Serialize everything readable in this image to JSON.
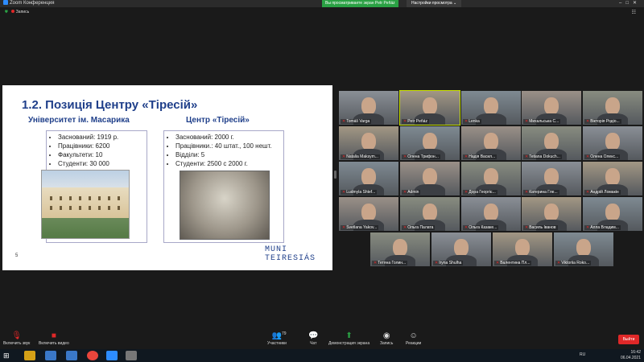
{
  "window": {
    "title": "Zoom Конференция",
    "share_banner": "Вы просматриваете экран Petr Peňáz",
    "view_options": "Настройки просмотра ⌄",
    "view_label": "☷"
  },
  "recording": {
    "label": "Запись"
  },
  "slide": {
    "title": "1.2. Позиція Центру «Тіресій»",
    "left": {
      "heading": "Університет ім. Масарика",
      "items": [
        "Заснований: 1919 р.",
        "Працівники: 6200",
        "Факультети: 10",
        "Студенти: 30 000"
      ]
    },
    "right": {
      "heading": "Центр «Тіресій»",
      "items": [
        "Заснований: 2000 г.",
        "Працівники.: 40 штат., 100 нешт.",
        "Відділи: 5",
        "Студенти: 2500 с 2000 г."
      ]
    },
    "page_number": "5",
    "logo_line1": "MUNI",
    "logo_line2": "TEIRESIÁS"
  },
  "participants": [
    "Tomáš Varga",
    "Petr Peňáz",
    "Lenka",
    "Михальська С...",
    "Вікторія Родіо...",
    "Natalia Maksym...",
    "Олена Трифон...",
    "Надія Васил...",
    "Tetiana Dokuch...",
    "Олена Олекс...",
    "Ludmyla Shtef...",
    "Admin",
    "Дора Георгіє...",
    "Катерина Гле...",
    "Андрій Ломакін",
    "Svetlana Yakov...",
    "Ольга Палата",
    "Ольга Казаке...",
    "Василь Іванов",
    "Алла Владим...",
    "Тетяна Голин...",
    "Iryna Shulha",
    "Валентина Пл...",
    "Viktoriia Roko..."
  ],
  "toolbar": {
    "mute": "Включить звук",
    "video": "Включить видео",
    "participants": "Участники",
    "participants_count": "79",
    "chat": "Чат",
    "share": "Демонстрация экрана",
    "record": "Запись",
    "reactions": "Реакции",
    "end": "Выйти"
  },
  "taskbar": {
    "lang": "RU",
    "time": "16:42",
    "date": "06.04.2021"
  }
}
